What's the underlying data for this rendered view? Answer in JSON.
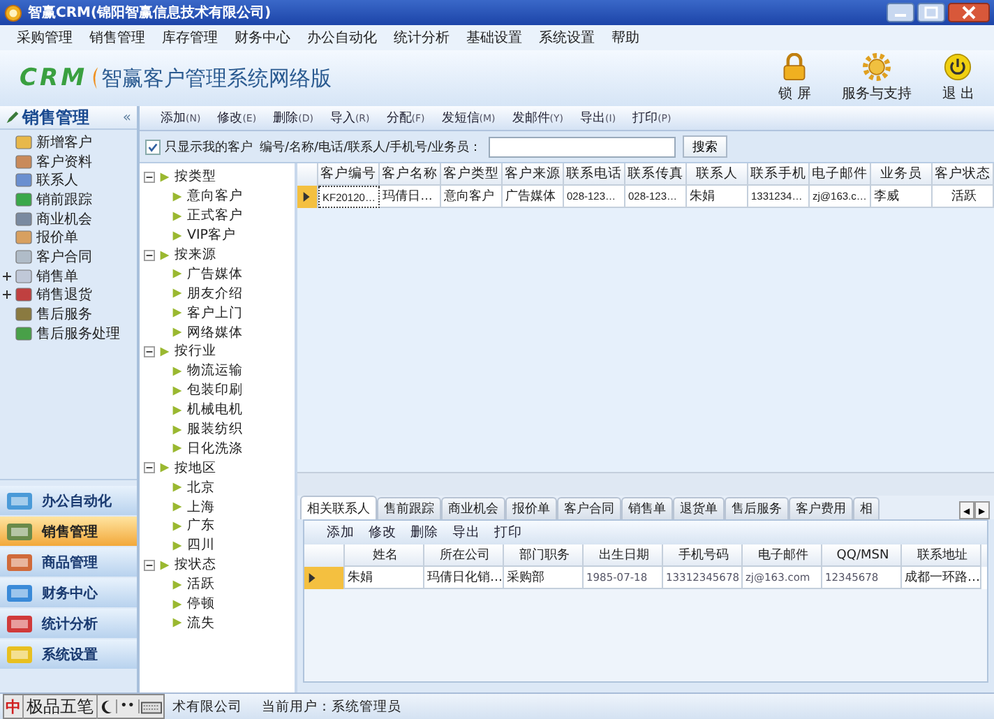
{
  "window": {
    "title": "智赢CRM(锦阳智赢信息技术有限公司)"
  },
  "menu": [
    "采购管理",
    "销售管理",
    "库存管理",
    "财务中心",
    "办公自动化",
    "统计分析",
    "基础设置",
    "系统设置",
    "帮助"
  ],
  "header": {
    "logo": "CRM",
    "product": "智赢客户管理系统网络版",
    "actions": [
      {
        "kind": "lock",
        "label": "锁 屏"
      },
      {
        "kind": "support",
        "label": "服务与支持"
      },
      {
        "kind": "exit",
        "label": "退 出"
      }
    ]
  },
  "sidebar": {
    "title": "销售管理",
    "collapse": "«",
    "items": [
      {
        "label": "新增客户",
        "kind": "leaf"
      },
      {
        "label": "客户资料",
        "kind": "leaf"
      },
      {
        "label": "联系人",
        "kind": "leaf"
      },
      {
        "label": "销前跟踪",
        "kind": "leaf"
      },
      {
        "label": "商业机会",
        "kind": "leaf"
      },
      {
        "label": "报价单",
        "kind": "leaf"
      },
      {
        "label": "客户合同",
        "kind": "leaf"
      },
      {
        "label": "销售单",
        "kind": "node"
      },
      {
        "label": "销售退货",
        "kind": "node"
      },
      {
        "label": "售后服务",
        "kind": "leaf"
      },
      {
        "label": "售后服务处理",
        "kind": "leaf"
      }
    ],
    "modules": [
      {
        "label": "办公自动化",
        "selected": false
      },
      {
        "label": "销售管理",
        "selected": true
      },
      {
        "label": "商品管理",
        "selected": false
      },
      {
        "label": "财务中心",
        "selected": false
      },
      {
        "label": "统计分析",
        "selected": false
      },
      {
        "label": "系统设置",
        "selected": false
      }
    ]
  },
  "toolbar": [
    {
      "label": "添加",
      "key": "(N)"
    },
    {
      "label": "修改",
      "key": "(E)"
    },
    {
      "label": "删除",
      "key": "(D)"
    },
    {
      "label": "导入",
      "key": "(R)"
    },
    {
      "label": "分配",
      "key": "(F)"
    },
    {
      "label": "发短信",
      "key": "(M)"
    },
    {
      "label": "发邮件",
      "key": "(Y)"
    },
    {
      "label": "导出",
      "key": "(I)"
    },
    {
      "label": "打印",
      "key": "(P)"
    }
  ],
  "filter": {
    "only_mine": {
      "label": "只显示我的客户",
      "checked": true
    },
    "search_label": "编号/名称/电话/联系人/手机号/业务员：",
    "search_button": "搜索"
  },
  "tree": [
    {
      "label": "按类型",
      "expanded": true,
      "children": [
        {
          "label": "意向客户"
        },
        {
          "label": "正式客户"
        },
        {
          "label": "VIP客户"
        }
      ]
    },
    {
      "label": "按来源",
      "expanded": true,
      "children": [
        {
          "label": "广告媒体"
        },
        {
          "label": "朋友介绍"
        },
        {
          "label": "客户上门"
        },
        {
          "label": "网络媒体"
        }
      ]
    },
    {
      "label": "按行业",
      "expanded": true,
      "children": [
        {
          "label": "物流运输"
        },
        {
          "label": "包装印刷"
        },
        {
          "label": "机械电机"
        },
        {
          "label": "服装纺织"
        },
        {
          "label": "日化洗涤"
        }
      ]
    },
    {
      "label": "按地区",
      "expanded": true,
      "children": [
        {
          "label": "北京"
        },
        {
          "label": "上海"
        },
        {
          "label": "广东"
        },
        {
          "label": "四川"
        }
      ]
    },
    {
      "label": "按状态",
      "expanded": true,
      "children": [
        {
          "label": "活跃"
        },
        {
          "label": "停顿"
        },
        {
          "label": "流失"
        }
      ]
    }
  ],
  "table": {
    "columns": [
      "客户编号",
      "客户名称",
      "客户类型",
      "客户来源",
      "联系电话",
      "联系传真",
      "联系人",
      "联系手机",
      "电子邮件",
      "业务员",
      "客户状态"
    ],
    "rows": [
      {
        "selected": true,
        "cells": [
          "KF20120…",
          "玛倩日…",
          "意向客户",
          "广告媒体",
          "028-123…",
          "028-123…",
          "朱娟",
          "1331234…",
          "zj@163.c…",
          "李威",
          "活跃"
        ]
      }
    ]
  },
  "detail": {
    "tabs": [
      {
        "label": "相关联系人",
        "selected": true
      },
      {
        "label": "售前跟踪",
        "selected": false
      },
      {
        "label": "商业机会",
        "selected": false
      },
      {
        "label": "报价单",
        "selected": false
      },
      {
        "label": "客户合同",
        "selected": false
      },
      {
        "label": "销售单",
        "selected": false
      },
      {
        "label": "退货单",
        "selected": false
      },
      {
        "label": "售后服务",
        "selected": false
      },
      {
        "label": "客户费用",
        "selected": false
      },
      {
        "label": "相",
        "selected": false
      }
    ],
    "scroll": [
      "◀",
      "▶"
    ],
    "toolbar": [
      "添加",
      "修改",
      "删除",
      "导出",
      "打印"
    ],
    "columns": [
      "姓名",
      "所在公司",
      "部门职务",
      "出生日期",
      "手机号码",
      "电子邮件",
      "QQ/MSN",
      "联系地址"
    ],
    "rows": [
      {
        "selected": true,
        "cells": [
          "朱娟",
          "玛倩日化销…",
          "采购部",
          "1985-07-18",
          "13312345678",
          "zj@163.com",
          "12345678",
          "成都一环路…"
        ]
      }
    ]
  },
  "ime": {
    "mode": "中",
    "name": "极品五笔",
    "keys": [
      "••"
    ]
  },
  "status": [
    "术有限公司",
    "当前用户：系统管理员"
  ]
}
